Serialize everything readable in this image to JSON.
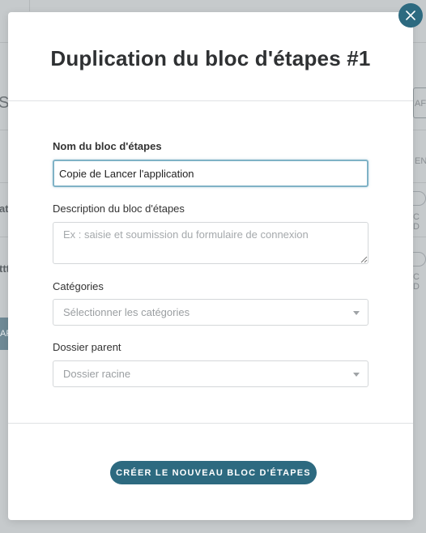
{
  "modal": {
    "title": "Duplication du bloc d'étapes #1",
    "close_icon": "close-icon",
    "fields": {
      "name": {
        "label": "Nom du bloc d'étapes",
        "value": "Copie de Lancer l'application"
      },
      "description": {
        "label": "Description du bloc d'étapes",
        "placeholder": "Ex : saisie et soumission du formulaire de connexion"
      },
      "categories": {
        "label": "Catégories",
        "placeholder": "Sélectionner les catégories"
      },
      "parent_folder": {
        "label": "Dossier parent",
        "value": "Dossier racine"
      }
    },
    "submit_label": "CRÉER LE NOUVEAU BLOC D'ÉTAPES"
  },
  "background": {
    "fragments": [
      "S",
      "AFF",
      "ENS",
      "at",
      "ttt",
      "C D",
      "C D",
      "AR"
    ]
  },
  "colors": {
    "accent": "#2d6a80",
    "focus_border": "#7fb2c6",
    "overlay": "#c6cacc"
  }
}
